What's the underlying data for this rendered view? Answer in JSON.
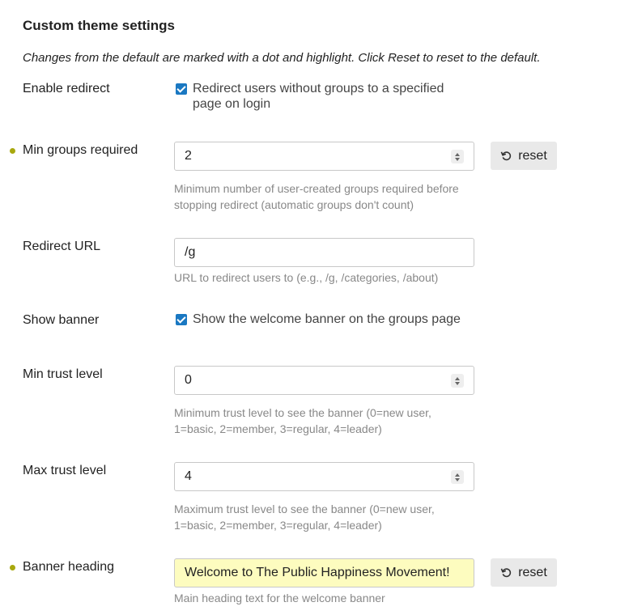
{
  "title": "Custom theme settings",
  "subtitle": "Changes from the default are marked with a dot and highlight. Click Reset to reset to the default.",
  "reset_label": "reset",
  "colors": {
    "modified_dot": "#a8a80e",
    "checkbox": "#1a78c2",
    "highlight": "#fdfcbf"
  },
  "settings": {
    "enable_redirect": {
      "label": "Enable redirect",
      "checked": true,
      "text_line1": "Redirect users without groups to a specified",
      "text_line2": "page on login"
    },
    "min_groups": {
      "label": "Min groups required",
      "value": "2",
      "modified": true,
      "help_line1": "Minimum number of user-created groups required before",
      "help_line2": "stopping redirect (automatic groups don't count)"
    },
    "redirect_url": {
      "label": "Redirect URL",
      "value": "/g",
      "help": "URL to redirect users to (e.g., /g, /categories, /about)"
    },
    "show_banner": {
      "label": "Show banner",
      "checked": true,
      "text": "Show the welcome banner on the groups page"
    },
    "min_trust": {
      "label": "Min trust level",
      "value": "0",
      "help_line1": "Minimum trust level to see the banner (0=new user,",
      "help_line2": "1=basic, 2=member, 3=regular, 4=leader)"
    },
    "max_trust": {
      "label": "Max trust level",
      "value": "4",
      "help_line1": "Maximum trust level to see the banner (0=new user,",
      "help_line2": "1=basic, 2=member, 3=regular, 4=leader)"
    },
    "banner_heading": {
      "label": "Banner heading",
      "value": "Welcome to The Public Happiness Movement!",
      "modified": true,
      "help": "Main heading text for the welcome banner"
    }
  }
}
